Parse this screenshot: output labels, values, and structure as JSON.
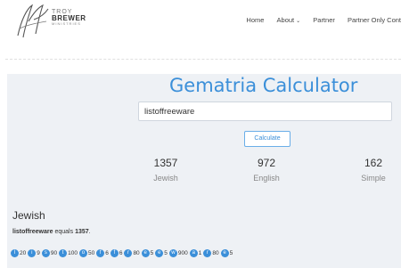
{
  "header": {
    "logo_line1": "TROY",
    "logo_line2": "BREWER",
    "logo_line3": "MINISTRIES",
    "nav": {
      "home": "Home",
      "about": "About",
      "partner": "Partner",
      "partner_only": "Partner Only Cont"
    }
  },
  "calculator": {
    "title": "Gematria Calculator",
    "input_value": "listoffreeware",
    "button_label": "Calculate"
  },
  "results": [
    {
      "value": "1357",
      "label": "Jewish"
    },
    {
      "value": "972",
      "label": "English"
    },
    {
      "value": "162",
      "label": "Simple"
    }
  ],
  "jewish_section": {
    "title": "Jewish",
    "word": "listoffreeware",
    "equals_text": " equals ",
    "total": "1357",
    "period": ".",
    "letters": [
      {
        "letter": "l",
        "value": "20"
      },
      {
        "letter": "i",
        "value": "9"
      },
      {
        "letter": "s",
        "value": "90"
      },
      {
        "letter": "t",
        "value": "100"
      },
      {
        "letter": "o",
        "value": "50"
      },
      {
        "letter": "f",
        "value": "6"
      },
      {
        "letter": "f",
        "value": "6"
      },
      {
        "letter": "r",
        "value": "80"
      },
      {
        "letter": "e",
        "value": "5"
      },
      {
        "letter": "e",
        "value": "5"
      },
      {
        "letter": "w",
        "value": "900"
      },
      {
        "letter": "a",
        "value": "1"
      },
      {
        "letter": "r",
        "value": "80"
      },
      {
        "letter": "e",
        "value": "5"
      }
    ]
  },
  "colors": {
    "accent": "#3b8fd9",
    "panel": "#eef1f5"
  }
}
